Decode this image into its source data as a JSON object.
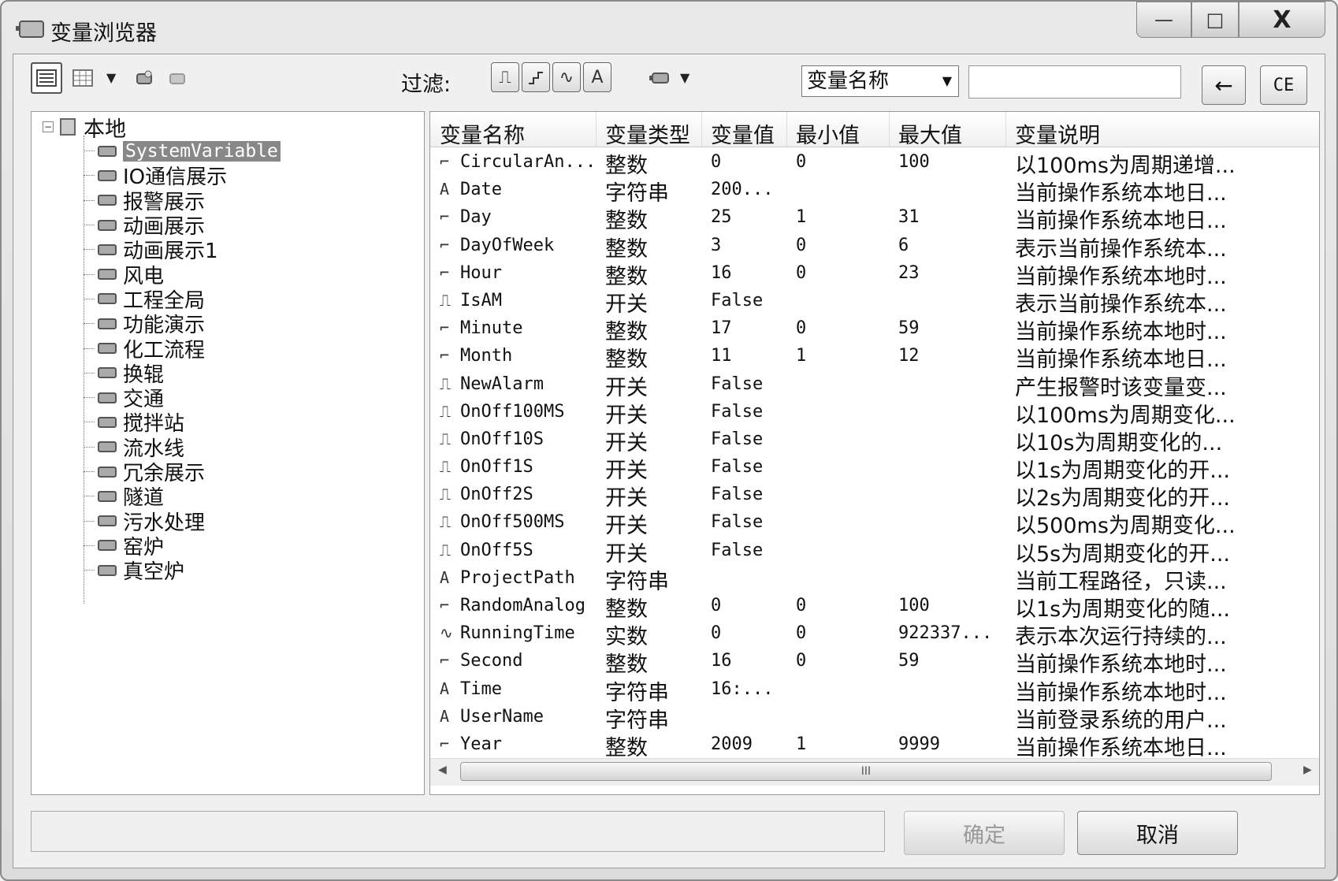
{
  "window": {
    "title": "变量浏览器",
    "minimize_glyph": "—",
    "maximize_glyph": "□",
    "close_glyph": "X"
  },
  "toolbar": {
    "filter_label": "过滤:",
    "filter_buttons": [
      "⎍",
      "⎍",
      "∿",
      "A"
    ],
    "search_field_select": "变量名称",
    "search_value": "",
    "back_button": "←",
    "ce_button": "CE"
  },
  "tree": {
    "root": "本地",
    "items": [
      "SystemVariable",
      "IO通信展示",
      "报警展示",
      "动画展示",
      "动画展示1",
      "风电",
      "工程全局",
      "功能演示",
      "化工流程",
      "换辊",
      "交通",
      "搅拌站",
      "流水线",
      "冗余展示",
      "隧道",
      "污水处理",
      "窑炉",
      "真空炉"
    ]
  },
  "grid": {
    "columns": [
      "变量名称",
      "变量类型",
      "变量值",
      "最小值",
      "最大值",
      "变量说明"
    ],
    "rows": [
      {
        "icon": "⌐",
        "name": "CircularAn...",
        "type": "整数",
        "value": "0",
        "min": "0",
        "max": "100",
        "desc": "以100ms为周期递增..."
      },
      {
        "icon": "A",
        "name": "Date",
        "type": "字符串",
        "value": "200...",
        "min": "",
        "max": "",
        "desc": "当前操作系统本地日..."
      },
      {
        "icon": "⌐",
        "name": "Day",
        "type": "整数",
        "value": "25",
        "min": "1",
        "max": "31",
        "desc": "当前操作系统本地日..."
      },
      {
        "icon": "⌐",
        "name": "DayOfWeek",
        "type": "整数",
        "value": "3",
        "min": "0",
        "max": "6",
        "desc": "表示当前操作系统本..."
      },
      {
        "icon": "⌐",
        "name": "Hour",
        "type": "整数",
        "value": "16",
        "min": "0",
        "max": "23",
        "desc": "当前操作系统本地时..."
      },
      {
        "icon": "⎍",
        "name": "IsAM",
        "type": "开关",
        "value": "False",
        "min": "",
        "max": "",
        "desc": "表示当前操作系统本..."
      },
      {
        "icon": "⌐",
        "name": "Minute",
        "type": "整数",
        "value": "17",
        "min": "0",
        "max": "59",
        "desc": "当前操作系统本地时..."
      },
      {
        "icon": "⌐",
        "name": "Month",
        "type": "整数",
        "value": "11",
        "min": "1",
        "max": "12",
        "desc": "当前操作系统本地日..."
      },
      {
        "icon": "⎍",
        "name": "NewAlarm",
        "type": "开关",
        "value": "False",
        "min": "",
        "max": "",
        "desc": "产生报警时该变量变..."
      },
      {
        "icon": "⎍",
        "name": "OnOff100MS",
        "type": "开关",
        "value": "False",
        "min": "",
        "max": "",
        "desc": "以100ms为周期变化..."
      },
      {
        "icon": "⎍",
        "name": "OnOff10S",
        "type": "开关",
        "value": "False",
        "min": "",
        "max": "",
        "desc": "以10s为周期变化的..."
      },
      {
        "icon": "⎍",
        "name": "OnOff1S",
        "type": "开关",
        "value": "False",
        "min": "",
        "max": "",
        "desc": "以1s为周期变化的开..."
      },
      {
        "icon": "⎍",
        "name": "OnOff2S",
        "type": "开关",
        "value": "False",
        "min": "",
        "max": "",
        "desc": "以2s为周期变化的开..."
      },
      {
        "icon": "⎍",
        "name": "OnOff500MS",
        "type": "开关",
        "value": "False",
        "min": "",
        "max": "",
        "desc": "以500ms为周期变化..."
      },
      {
        "icon": "⎍",
        "name": "OnOff5S",
        "type": "开关",
        "value": "False",
        "min": "",
        "max": "",
        "desc": "以5s为周期变化的开..."
      },
      {
        "icon": "A",
        "name": "ProjectPath",
        "type": "字符串",
        "value": "",
        "min": "",
        "max": "",
        "desc": "当前工程路径，只读..."
      },
      {
        "icon": "⌐",
        "name": "RandomAnalog",
        "type": "整数",
        "value": "0",
        "min": "0",
        "max": "100",
        "desc": "以1s为周期变化的随..."
      },
      {
        "icon": "∿",
        "name": "RunningTime",
        "type": "实数",
        "value": "0",
        "min": "0",
        "max": "922337...",
        "desc": "表示本次运行持续的..."
      },
      {
        "icon": "⌐",
        "name": "Second",
        "type": "整数",
        "value": "16",
        "min": "0",
        "max": "59",
        "desc": "当前操作系统本地时..."
      },
      {
        "icon": "A",
        "name": "Time",
        "type": "字符串",
        "value": "16:...",
        "min": "",
        "max": "",
        "desc": "当前操作系统本地时..."
      },
      {
        "icon": "A",
        "name": "UserName",
        "type": "字符串",
        "value": "",
        "min": "",
        "max": "",
        "desc": "当前登录系统的用户..."
      },
      {
        "icon": "⌐",
        "name": "Year",
        "type": "整数",
        "value": "2009",
        "min": "1",
        "max": "9999",
        "desc": "当前操作系统本地日..."
      }
    ],
    "scroll_grip": "III"
  },
  "footer": {
    "status_text": "",
    "ok_label": "确定",
    "cancel_label": "取消"
  }
}
